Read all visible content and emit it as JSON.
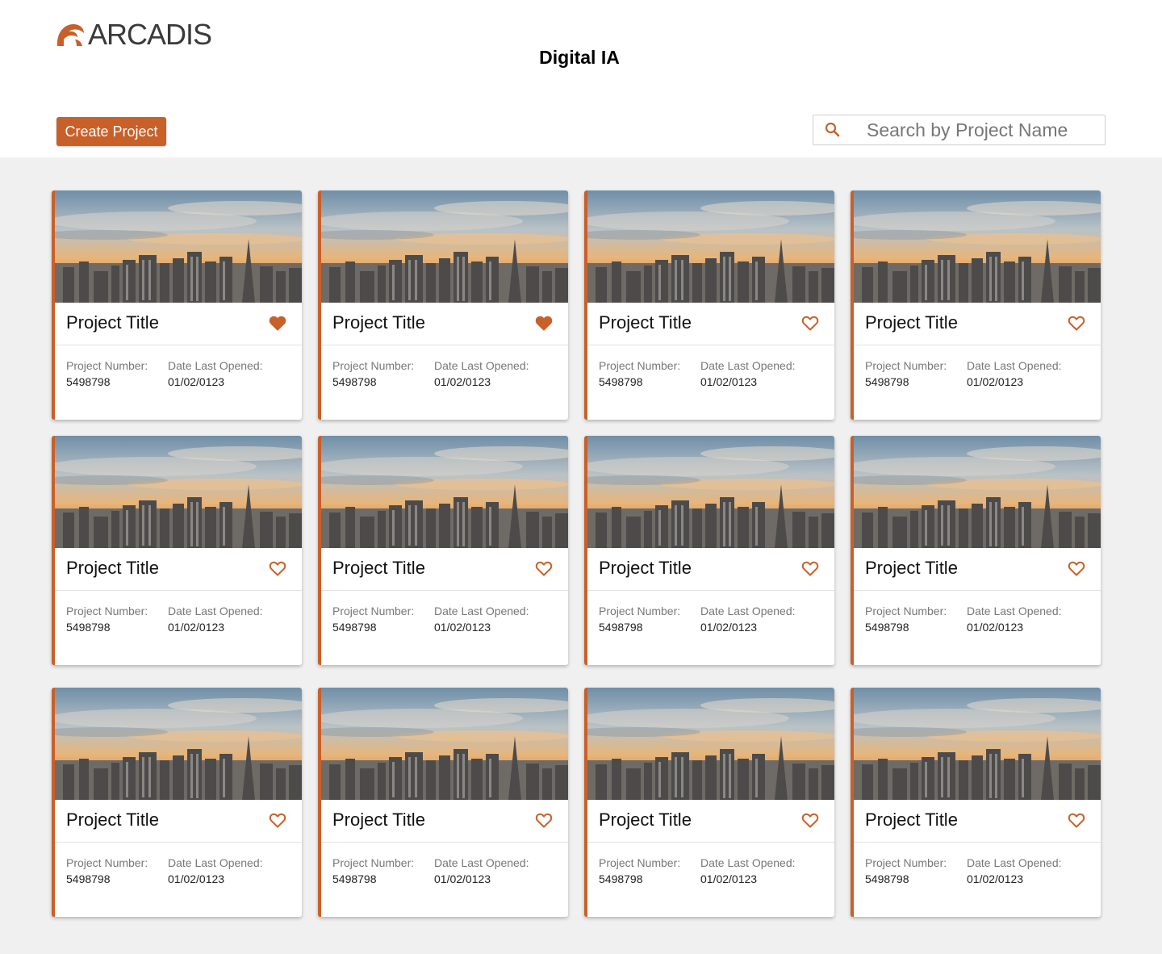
{
  "brand": {
    "logo_text": "ARCADIS",
    "accent_color": "#c8602a"
  },
  "header": {
    "title": "Digital IA"
  },
  "toolbar": {
    "create_label": "Create Project"
  },
  "search": {
    "placeholder": "Search by Project Name",
    "icon": "search-icon"
  },
  "card_labels": {
    "number_label": "Project Number:",
    "date_label": "Date Last Opened:"
  },
  "projects": [
    {
      "title": "Project Title",
      "number": "5498798",
      "date": "01/02/0123",
      "favorite": true
    },
    {
      "title": "Project Title",
      "number": "5498798",
      "date": "01/02/0123",
      "favorite": true
    },
    {
      "title": "Project Title",
      "number": "5498798",
      "date": "01/02/0123",
      "favorite": false
    },
    {
      "title": "Project Title",
      "number": "5498798",
      "date": "01/02/0123",
      "favorite": false
    },
    {
      "title": "Project Title",
      "number": "5498798",
      "date": "01/02/0123",
      "favorite": false
    },
    {
      "title": "Project Title",
      "number": "5498798",
      "date": "01/02/0123",
      "favorite": false
    },
    {
      "title": "Project Title",
      "number": "5498798",
      "date": "01/02/0123",
      "favorite": false
    },
    {
      "title": "Project Title",
      "number": "5498798",
      "date": "01/02/0123",
      "favorite": false
    },
    {
      "title": "Project Title",
      "number": "5498798",
      "date": "01/02/0123",
      "favorite": false
    },
    {
      "title": "Project Title",
      "number": "5498798",
      "date": "01/02/0123",
      "favorite": false
    },
    {
      "title": "Project Title",
      "number": "5498798",
      "date": "01/02/0123",
      "favorite": false
    },
    {
      "title": "Project Title",
      "number": "5498798",
      "date": "01/02/0123",
      "favorite": false
    }
  ]
}
